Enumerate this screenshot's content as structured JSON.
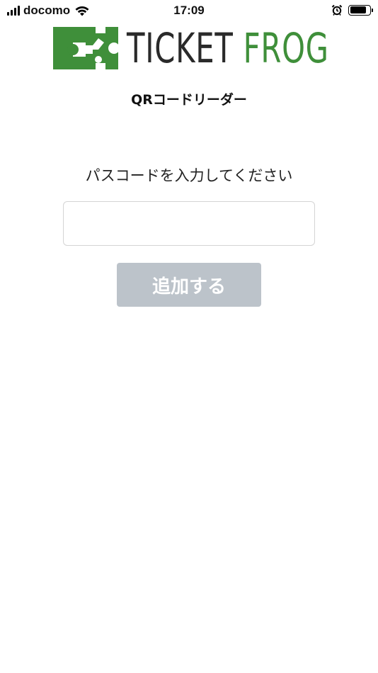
{
  "status_bar": {
    "carrier": "docomo",
    "time": "17:09",
    "signal_bars": 4,
    "battery_level": 0.85
  },
  "logo": {
    "word1": "TICKET",
    "word2": "FROG",
    "brand_green": "#3f8f3a",
    "brand_dark": "#2a2a2a"
  },
  "header": {
    "title": "QRコードリーダー"
  },
  "form": {
    "prompt": "パスコードを入力してください",
    "passcode_value": "",
    "passcode_placeholder": "",
    "submit_label": "追加する",
    "submit_color": "#bcc3ca"
  }
}
